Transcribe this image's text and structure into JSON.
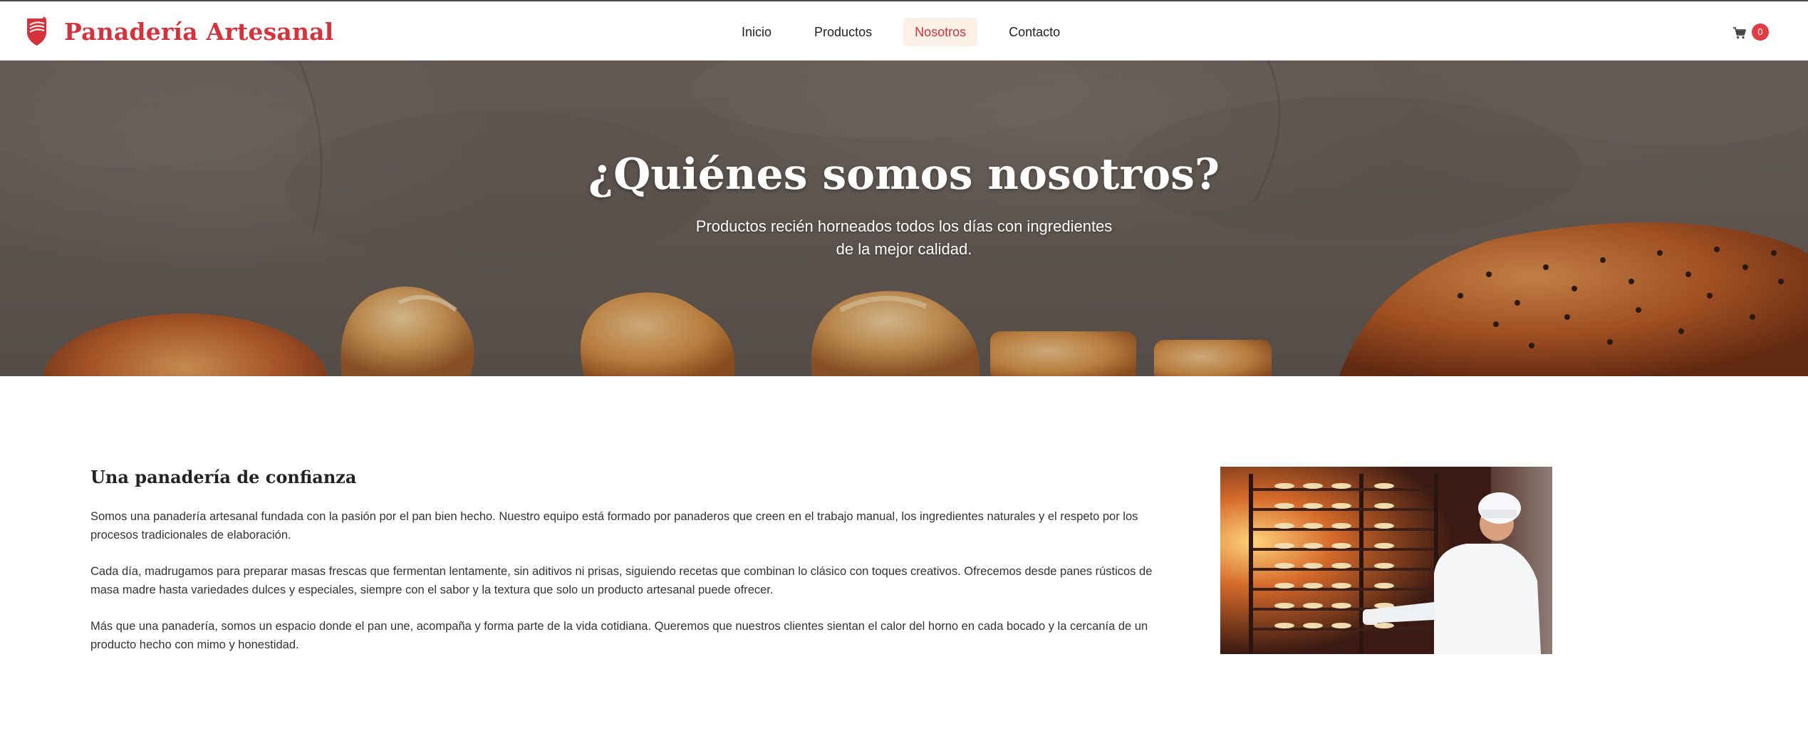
{
  "header": {
    "brand": {
      "name": "Panadería Artesanal",
      "icon": "bread-shield-logo-icon",
      "color": "#d6323c"
    },
    "nav": [
      {
        "label": "Inicio",
        "active": false
      },
      {
        "label": "Productos",
        "active": false
      },
      {
        "label": "Nosotros",
        "active": true
      },
      {
        "label": "Contacto",
        "active": false
      }
    ],
    "cart": {
      "icon": "cart-icon",
      "count": "0",
      "badge_color": "#e33b44"
    }
  },
  "hero": {
    "title": "¿Quiénes somos nosotros?",
    "subtitle": "Productos recién horneados todos los días con ingredientes de la mejor calidad."
  },
  "about": {
    "heading": "Una panadería de confianza",
    "paragraphs": [
      "Somos una panadería artesanal fundada con la pasión por el pan bien hecho. Nuestro equipo está formado por panaderos que creen en el trabajo manual, los ingredientes naturales y el respeto por los procesos tradicionales de elaboración.",
      "Cada día, madrugamos para preparar masas frescas que fermentan lentamente, sin aditivos ni prisas, siguiendo recetas que combinan lo clásico con toques creativos. Ofrecemos desde panes rústicos de masa madre hasta variedades dulces y especiales, siempre con el sabor y la textura que solo un producto artesanal puede ofrecer.",
      "Más que una panadería, somos un espacio donde el pan une, acompaña y forma parte de la vida cotidiana. Queremos que nuestros clientes sientan el calor del horno en cada bocado y la cercanía de un producto hecho con mimo y honestidad."
    ]
  },
  "colors": {
    "accent": "#d6323c",
    "nav_active_bg": "#fdf0e6",
    "text": "#333333"
  }
}
